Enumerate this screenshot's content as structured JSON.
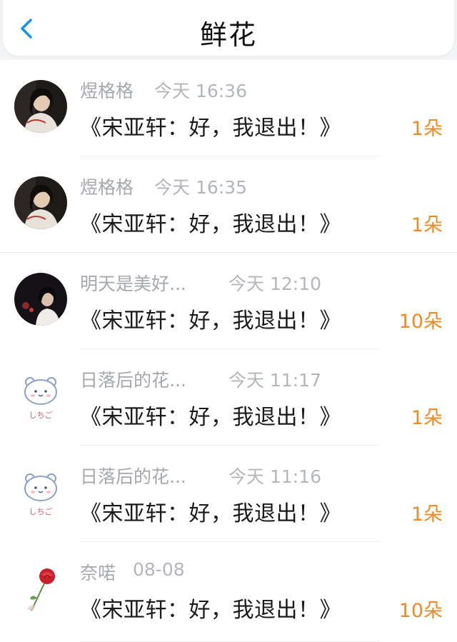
{
  "header": {
    "title": "鲜花",
    "back_icon": "chevron-left-icon"
  },
  "colors": {
    "accent_blue": "#1a8fe8",
    "count_orange": "#f08a24",
    "name_gray": "#a5a8ac"
  },
  "items": [
    {
      "name": "煜格格",
      "time": "今天 16:36",
      "book": "《宋亚轩：好，我退出！》",
      "count": "1朵",
      "avatar": "girl-portrait-avatar"
    },
    {
      "name": "煜格格",
      "time": "今天 16:35",
      "book": "《宋亚轩：好，我退出！》",
      "count": "1朵",
      "avatar": "girl-portrait-avatar"
    },
    {
      "name": "明天是美好...",
      "time": "今天 12:10",
      "book": "《宋亚轩：好，我退出！》",
      "count": "10朵",
      "avatar": "dark-portrait-avatar"
    },
    {
      "name": "日落后的花...",
      "time": "今天 11:17",
      "book": "《宋亚轩：好，我退出！》",
      "count": "1朵",
      "avatar": "bear-avatar",
      "avatar_caption": "しちご"
    },
    {
      "name": "日落后的花...",
      "time": "今天 11:16",
      "book": "《宋亚轩：好，我退出！》",
      "count": "1朵",
      "avatar": "bear-avatar",
      "avatar_caption": "しちご"
    },
    {
      "name": "奈喏",
      "time": "08-08",
      "book": "《宋亚轩：好，我退出！》",
      "count": "10朵",
      "avatar": "rose-avatar"
    }
  ]
}
